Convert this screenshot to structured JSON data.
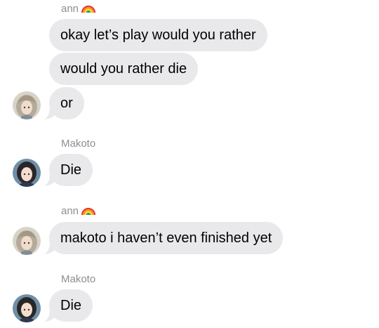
{
  "colors": {
    "bubble_bg": "#e9e9eb",
    "sender_text": "#8e8e93",
    "message_text": "#000000"
  },
  "messages": [
    {
      "sender": "ann",
      "sender_icon": "rainbow-emoji",
      "text": "okay let’s play would you rather"
    },
    {
      "text": "would you rather die"
    },
    {
      "text": "or"
    },
    {
      "sender": "Makoto",
      "text": "Die"
    },
    {
      "sender": "ann",
      "sender_icon": "rainbow-emoji",
      "text": "makoto i haven’t even finished yet"
    },
    {
      "sender": "Makoto",
      "text": "Die"
    }
  ]
}
